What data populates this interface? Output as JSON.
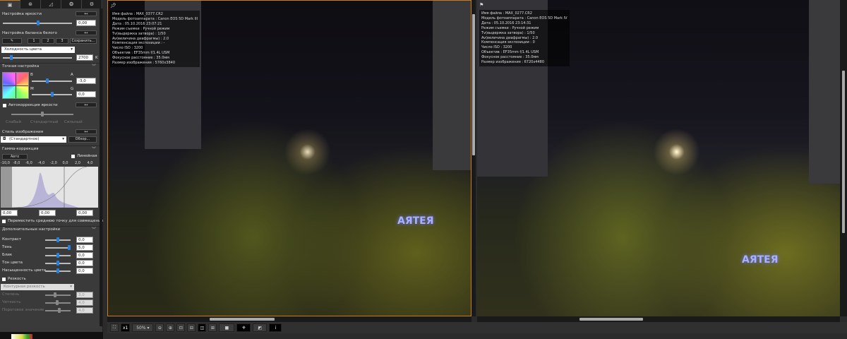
{
  "panel": {
    "tabs": [
      "basic-icon",
      "detail-icon",
      "tone-curve-icon",
      "color-icon",
      "settings-icon"
    ],
    "brightness": {
      "title": "Настройка яркости",
      "value": "0,00",
      "reset": "↤"
    },
    "wb": {
      "title": "Настройка баланса белого",
      "presets": [
        "1",
        "2",
        "3"
      ],
      "save": "Сохранить...",
      "mode": "Холодность цвета",
      "temp": "2700",
      "unit": "K"
    },
    "fine": {
      "title": "Точная настройка",
      "b": "B",
      "a": "A",
      "m": "M",
      "g": "G",
      "ba_value": "-3,0",
      "mg_value": "0,0"
    },
    "auto": {
      "title": "Автокоррекция яркости",
      "levels": [
        "Слабый",
        "Стандартный",
        "Сильный"
      ]
    },
    "style": {
      "title": "Стиль изображения",
      "value": "(Стандартное)",
      "browse": "Обзор..."
    },
    "gamma": {
      "title": "Гамма-коррекция",
      "auto": "Авто",
      "linear": "Линейная",
      "ticks": [
        "-10,0",
        "-8,0",
        "-6,0",
        "-4,0",
        "-2,0",
        "0,0",
        "2,0",
        "4,0"
      ],
      "left": "0,00",
      "mid": "0,00",
      "right": "0,00",
      "move_mid": "Переместить среднюю точку для совмещения"
    },
    "advanced": {
      "title": "Дополнительные настройки",
      "rows": [
        {
          "label": "Контраст",
          "value": "0,0",
          "pos": 0.5
        },
        {
          "label": "Тень",
          "value": "5,0",
          "pos": 1.0
        },
        {
          "label": "Блик",
          "value": "0,0",
          "pos": 0.5
        },
        {
          "label": "Тон цвета",
          "value": "0,0",
          "pos": 0.5
        },
        {
          "label": "Насыщенность цвета",
          "value": "0,0",
          "pos": 0.5
        }
      ]
    },
    "sharp": {
      "title": "Резкость",
      "mode": "Контурная резкость",
      "rows": [
        {
          "label": "Степень",
          "value": "3,0"
        },
        {
          "label": "Четкость",
          "value": "4,0"
        },
        {
          "label": "Пороговое значение",
          "value": "4,0"
        }
      ]
    }
  },
  "left_info": [
    "Имя файла : MAX_0377.CR2",
    "Модель фотоаппарата : Canon EOS 5D Mark III",
    "Дата : 05.10.2016 23:07:21",
    "Режим съемки : Ручной режим",
    "Tv(выдержка затвора) : 1/50",
    "Av(величина диафрагмы) : 2.0",
    "Компенсация экспозиции : -",
    "Число ISO : 3200",
    "Объектив : EF35mm f/1.4L USM",
    "Фокусное расстояние : 35.0мм",
    "Размер изображения : 5760x3840"
  ],
  "right_info": [
    "Имя файла : MAX_0277.CR2",
    "Модель фотоаппарата : Canon EOS 5D Mark IV",
    "Дата : 05.10.2016 23:14:31",
    "Режим съемки : Ручной режим",
    "Tv(выдержка затвора) : 1/50",
    "Av(величина диафрагмы) : 2.0",
    "Компенсация экспозиции : 0",
    "Число ISO : 3200",
    "Объектив : EF35mm f/1.4L USM",
    "Фокусное расстояние : 35.0мм",
    "Размер изображения : 6720x4480"
  ],
  "scene_sign": "АЯТЕЯ",
  "toolbar": {
    "fit": "⛶",
    "x1": "x1",
    "zoom": "50%",
    "zoom_out": "⊖",
    "zoom_in": "⊕",
    "info": "i"
  }
}
